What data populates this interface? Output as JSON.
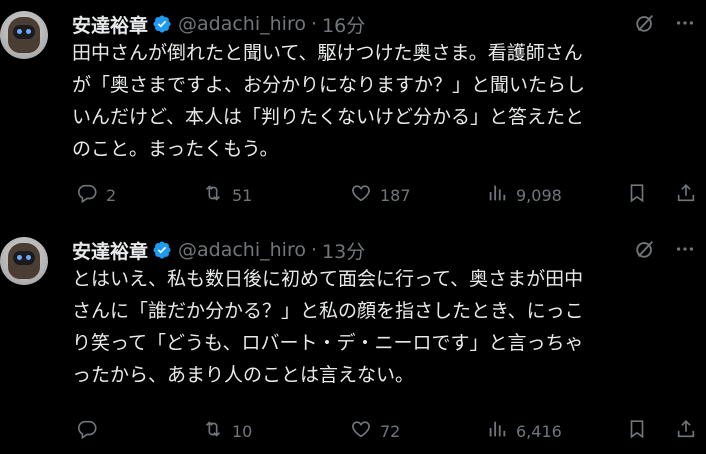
{
  "tweets": [
    {
      "display_name": "安達裕章",
      "handle": "@adachi_hiro",
      "separator": "·",
      "time": "16分",
      "text": "田中さんが倒れたと聞いて、駆けつけた奥さま。看護師さん\nが「奥さまですよ、お分かりになりますか？」と聞いたらし\nいんだけど、本人は「判りたくないけど分かる」と答えたと\nのこと。まったくもう。",
      "replies": "2",
      "reposts": "51",
      "likes": "187",
      "views": "9,098"
    },
    {
      "display_name": "安達裕章",
      "handle": "@adachi_hiro",
      "separator": "·",
      "time": "13分",
      "text": "とはいえ、私も数日後に初めて面会に行って、奥さまが田中\nさんに「誰だか分かる？」と私の顔を指さしたとき、にっこ\nり笑って「どうも、ロバート・デ・ニーロです」と言っちゃ\nったから、あまり人のことは言えない。",
      "replies": "",
      "reposts": "10",
      "likes": "72",
      "views": "6,416"
    }
  ],
  "icons": {
    "avatar": "robot-avatar",
    "verified": "verified-badge-icon",
    "grok": "grok-icon",
    "more": "more-icon",
    "reply": "reply-icon",
    "repost": "repost-icon",
    "like": "heart-icon",
    "views": "views-icon",
    "bookmark": "bookmark-icon",
    "share": "share-icon"
  },
  "colors": {
    "background": "#000000",
    "text": "#e7e9ea",
    "muted": "#71767b",
    "verified": "#1d9bf0"
  }
}
